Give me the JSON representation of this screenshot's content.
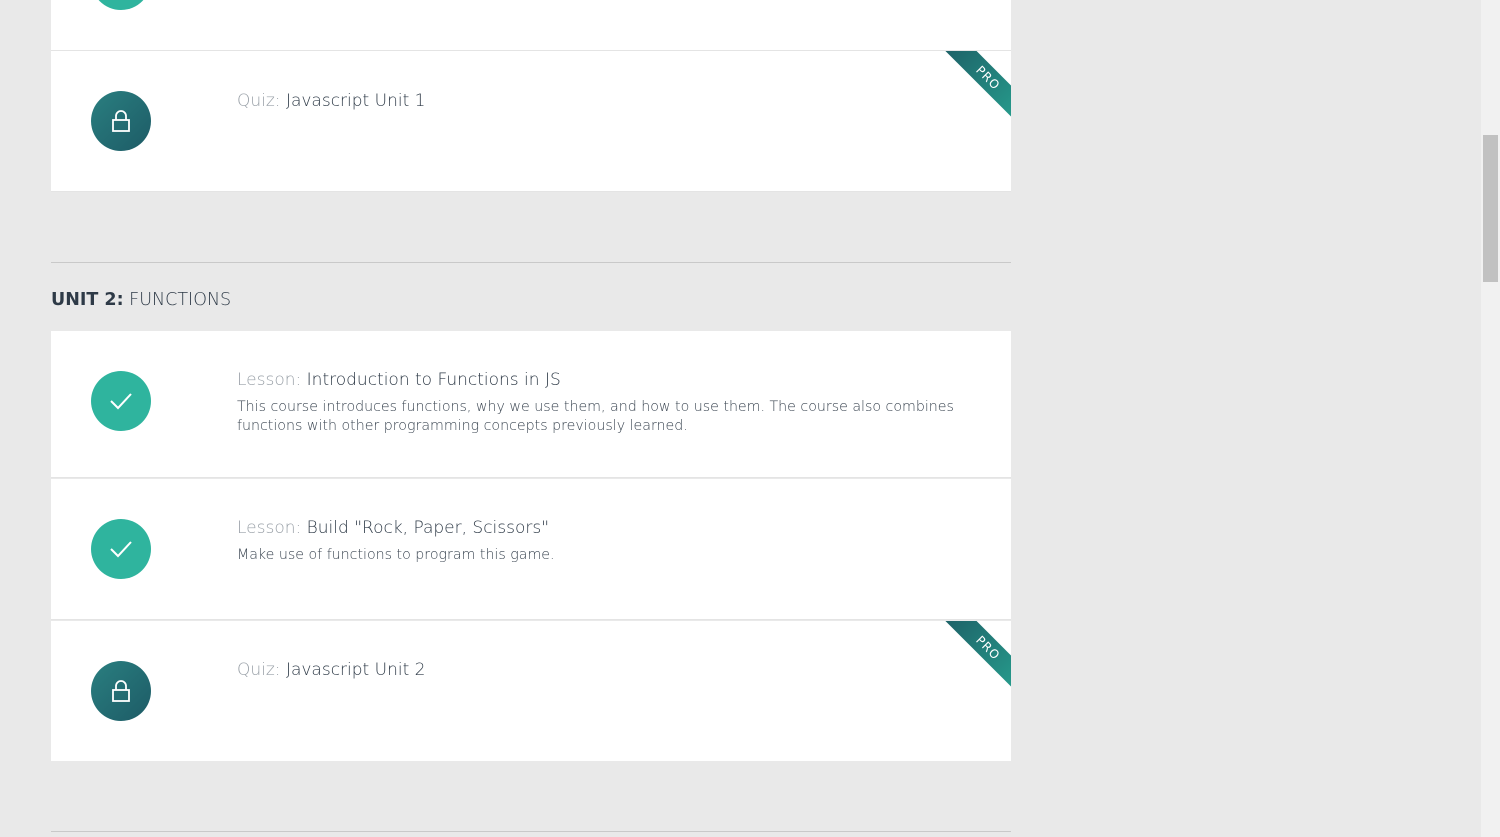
{
  "top_item": {
    "status": "completed",
    "icon": "check-icon"
  },
  "unit1_quiz": {
    "kind": "Quiz:",
    "name": "Javascript Unit 1",
    "status": "locked",
    "icon": "lock-icon",
    "badge": "PRO"
  },
  "unit2": {
    "label": "UNIT 2:",
    "name": "FUNCTIONS",
    "items": [
      {
        "kind": "Lesson:",
        "name": "Introduction to Functions in JS",
        "description": "This course introduces functions, why we use them, and how to use them. The course also combines functions with other programming concepts previously learned.",
        "status": "completed",
        "icon": "check-icon"
      },
      {
        "kind": "Lesson:",
        "name": "Build \"Rock, Paper, Scissors\"",
        "description": "Make use of functions to program this game.",
        "status": "completed",
        "icon": "check-icon"
      },
      {
        "kind": "Quiz:",
        "name": "Javascript Unit 2",
        "status": "locked",
        "icon": "lock-icon",
        "badge": "PRO"
      }
    ]
  },
  "colors": {
    "completed": "#2fb49e",
    "locked": "#1d5b66",
    "background": "#e9e9e9",
    "ribbon": "#1d5f66"
  }
}
